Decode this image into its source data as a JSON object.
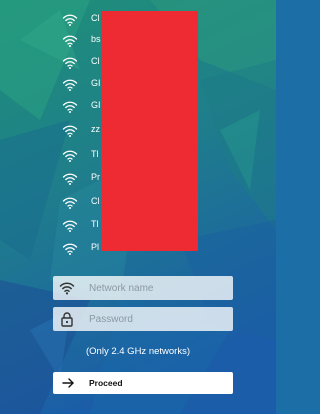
{
  "wifi_networks": [
    {
      "name": "Cl"
    },
    {
      "name": "bs"
    },
    {
      "name": "Cl"
    },
    {
      "name": "GI"
    },
    {
      "name": "GI"
    },
    {
      "name": "zz"
    },
    {
      "name": "Tl"
    },
    {
      "name": "Pr"
    },
    {
      "name": "Cl"
    },
    {
      "name": "Tl"
    },
    {
      "name": "Pl"
    }
  ],
  "form": {
    "network_name_placeholder": "Network name",
    "password_placeholder": "Password",
    "note": "(Only 2.4 GHz networks)",
    "proceed_label": "Proceed"
  },
  "colors": {
    "redaction": "#ee2b33",
    "background_top": "#1b8a7a",
    "background_bottom": "#1c5fa8"
  }
}
